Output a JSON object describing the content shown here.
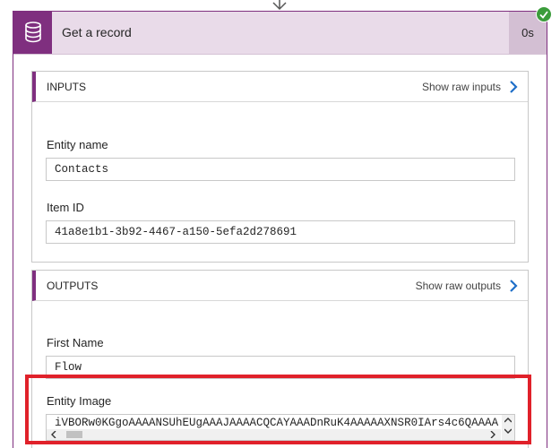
{
  "card": {
    "title": "Get a record",
    "duration": "0s",
    "icon": "database-icon",
    "status_icon": "check-circle-icon",
    "colors": {
      "accent": "#7f2f7f",
      "header_bg": "#e9dbe9",
      "duration_bg": "#d3bfd3",
      "success": "#3b9c3b",
      "highlight": "#e0212a"
    }
  },
  "inputs": {
    "title": "INPUTS",
    "raw_link": "Show raw inputs",
    "fields": [
      {
        "label": "Entity name",
        "value": "Contacts"
      },
      {
        "label": "Item ID",
        "value": "41a8e1b1-3b92-4467-a150-5efa2d278691"
      }
    ]
  },
  "outputs": {
    "title": "OUTPUTS",
    "raw_link": "Show raw outputs",
    "fields": [
      {
        "label": "First Name",
        "value": "Flow"
      },
      {
        "label": "Entity Image",
        "value": "iVBORw0KGgoAAAANSUhEUgAAAJAAAACQCAYAAADnRuK4AAAAAXNSR0IArs4c6QAAAA"
      }
    ]
  }
}
